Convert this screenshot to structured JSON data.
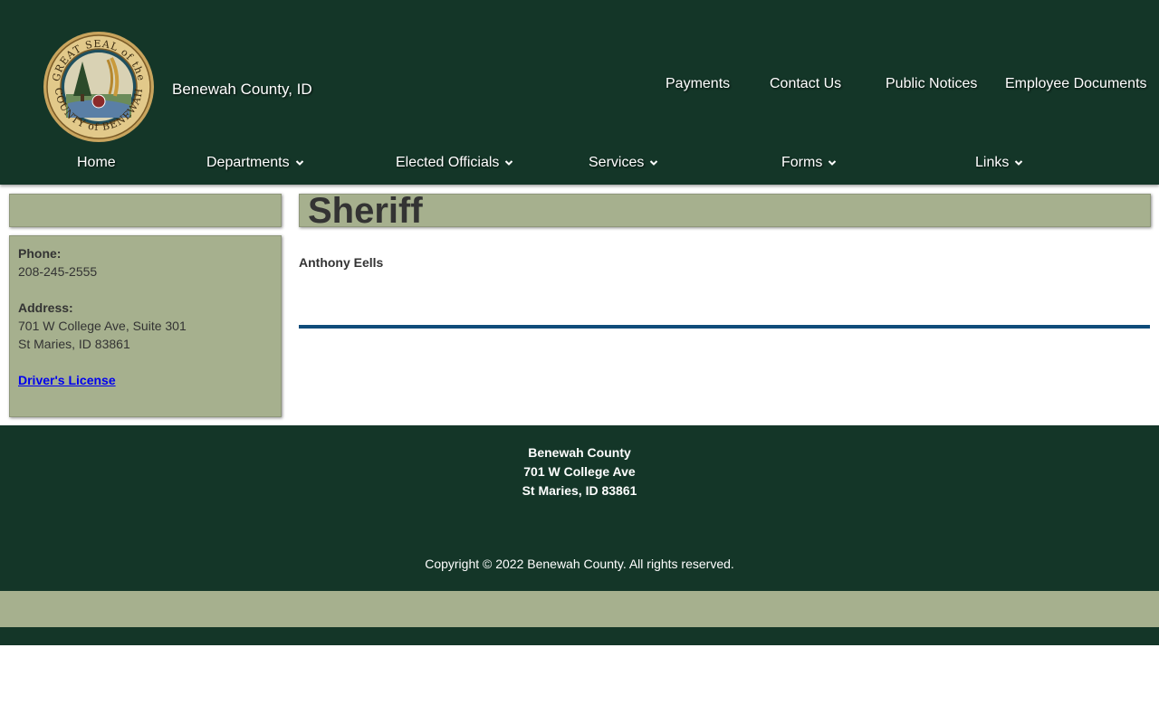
{
  "header": {
    "seal_text_top": "GREAT SEAL of the",
    "seal_text_bottom": "COUNTY of BENEWAH",
    "site_title": "Benewah County, ID",
    "top_links": [
      "Payments",
      "Contact Us",
      "Public Notices",
      "Employee Documents"
    ]
  },
  "nav": {
    "home": "Home",
    "departments": "Departments",
    "elected_officials": "Elected Officials",
    "services": "Services",
    "forms": "Forms",
    "links": "Links"
  },
  "sidebar": {
    "phone_label": "Phone:",
    "phone": "208-245-2555",
    "address_label": "Address:",
    "address_line1": "701 W College Ave, Suite 301",
    "address_line2": "St Maries, ID 83861",
    "drivers_license_link": "Driver's License"
  },
  "main": {
    "title": "Sheriff",
    "person": "Anthony Eells"
  },
  "footer": {
    "name": "Benewah County",
    "street": "701 W College Ave",
    "city": "St Maries, ID 83861",
    "copyright": "Copyright © 2022 Benewah County. All rights reserved."
  },
  "colors": {
    "header_bg": "#143628",
    "panel_bg": "#a6b08e",
    "divider": "#0f4c7a",
    "link": "#0000ee"
  },
  "icons": [
    "county-seal-logo",
    "chevron-down-icon"
  ]
}
